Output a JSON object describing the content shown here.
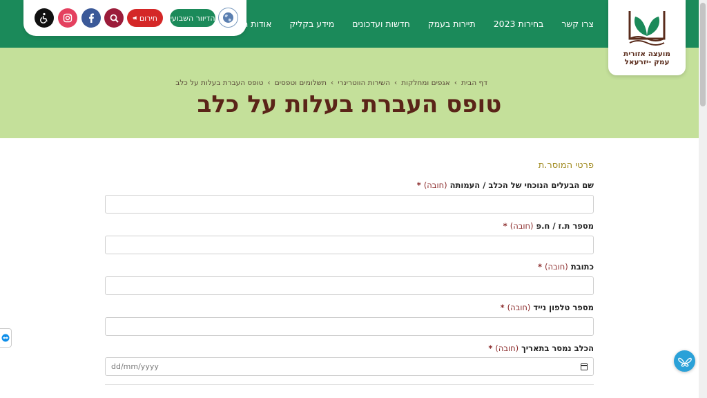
{
  "header": {
    "nav": [
      {
        "label": "אודות המועצה"
      },
      {
        "label": "מידע בקליק"
      },
      {
        "label": "חדשות ועדכונים"
      },
      {
        "label": "תיירות בעמק"
      },
      {
        "label": "בחירות 2023"
      },
      {
        "label": "צרו קשר"
      }
    ],
    "logo": {
      "line1": "מועצה אזורית",
      "line2": "עמק -יזרעאל"
    },
    "tools": {
      "weekly_label": "הדיוור השבועי",
      "emergency_label": "חירום",
      "colors": {
        "green": "#1b8a5a",
        "red": "#d42727",
        "facebook": "#3b5998",
        "search": "#9b1c3a",
        "accessibility": "#111111"
      }
    }
  },
  "hero": {
    "breadcrumb": [
      "דף הבית",
      "אגפים ומחלקות",
      "השירות הווטרינרי",
      "תשלומים וטפסים",
      "טופס העברת בעלות על כלב"
    ],
    "title": "טופס העברת בעלות על כלב"
  },
  "form": {
    "section_title": "פרטי המוסר.ת",
    "required_text": "(חובה)",
    "fields": [
      {
        "label": "שם הבעלים הנוכחי של הכלב / העמותה",
        "value": ""
      },
      {
        "label": "מספר ת.ז / ח.פ",
        "value": ""
      },
      {
        "label": "כתובת",
        "value": ""
      },
      {
        "label": "מספר טלפון נייד",
        "value": ""
      },
      {
        "label": "הכלב נמסר בתאריך",
        "placeholder": "dd/mm/yyyy"
      }
    ]
  }
}
